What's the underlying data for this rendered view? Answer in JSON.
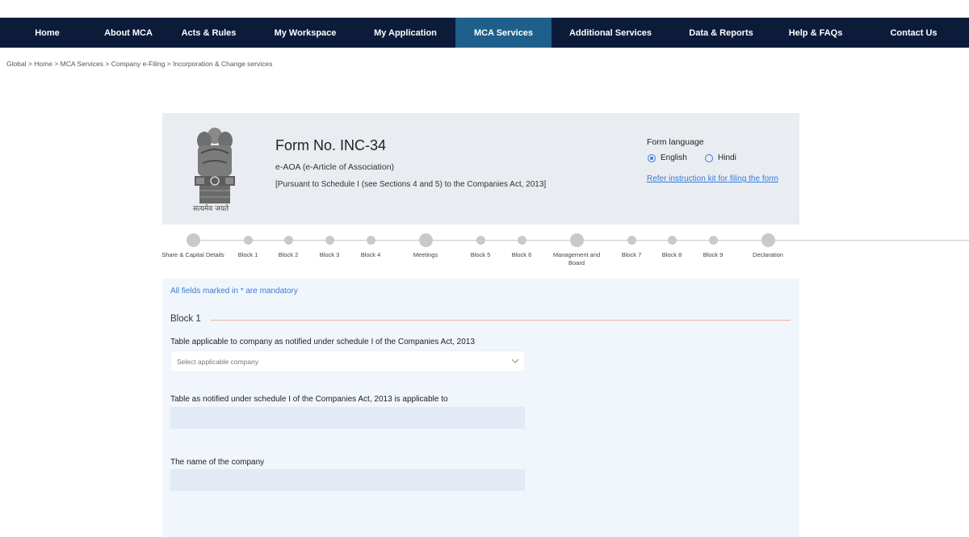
{
  "nav": {
    "items": [
      {
        "label": "Home",
        "width": 117
      },
      {
        "label": "About MCA",
        "width": 67
      },
      {
        "label": "Acts & Rules",
        "width": 150
      },
      {
        "label": "My Workspace",
        "width": 75
      },
      {
        "label": "My Application",
        "width": 175
      },
      {
        "label": "MCA Services",
        "width": 55,
        "active": true
      },
      {
        "label": "Additional Services",
        "width": 190
      },
      {
        "label": "Data & Reports",
        "width": 36
      },
      {
        "label": "Help & FAQs",
        "width": 204
      },
      {
        "label": "Contact Us",
        "width": 0
      }
    ]
  },
  "breadcrumb": {
    "items": [
      "Global",
      "Home",
      "MCA Services",
      "Company e-Filing",
      "Incorporation & Change services"
    ],
    "separator": " > "
  },
  "header": {
    "emblem_caption": "सत्यमेव जयते",
    "title": "Form No. INC-34",
    "subtitle": "e-AOA (e-Article of Association)",
    "pursuant": "[Pursuant to Schedule I (see Sections 4 and 5) to the Companies Act, 2013]",
    "language_label": "Form language",
    "lang_english": "English",
    "lang_hindi": "Hindi",
    "selected_language": "English",
    "instruction_link": "Refer instruction kit for filing the form"
  },
  "steps": [
    {
      "label": "Share & Capital Details"
    },
    {
      "label": "Block 1"
    },
    {
      "label": "Block 2"
    },
    {
      "label": "Block 3"
    },
    {
      "label": "Block 4"
    },
    {
      "label": "Meetings"
    },
    {
      "label": "Block 5"
    },
    {
      "label": "Block 6"
    },
    {
      "label": "Management and Board"
    },
    {
      "label": "Block 7"
    },
    {
      "label": "Block 8"
    },
    {
      "label": "Block 9"
    },
    {
      "label": "Declaration"
    }
  ],
  "form": {
    "mandatory_note": "All fields marked in * are mandatory",
    "block_title": "Block 1",
    "field1_label": "Table applicable to company as notified under schedule I of the Companies Act, 2013",
    "field1_placeholder": "Select applicable company",
    "field2_label": "Table as notified under schedule I of the Companies Act, 2013 is applicable to",
    "field2_value": "",
    "field3_label": "The name of the company",
    "field3_value": ""
  },
  "colors": {
    "nav_bg": "#0d1b3a",
    "nav_active": "#1f5f8b",
    "link": "#3a7bd5",
    "panel_bg": "#e9ecf1",
    "form_bg": "#f1f6fc",
    "input_bg": "#e2eaf6",
    "accent_line": "#e8b49a"
  }
}
